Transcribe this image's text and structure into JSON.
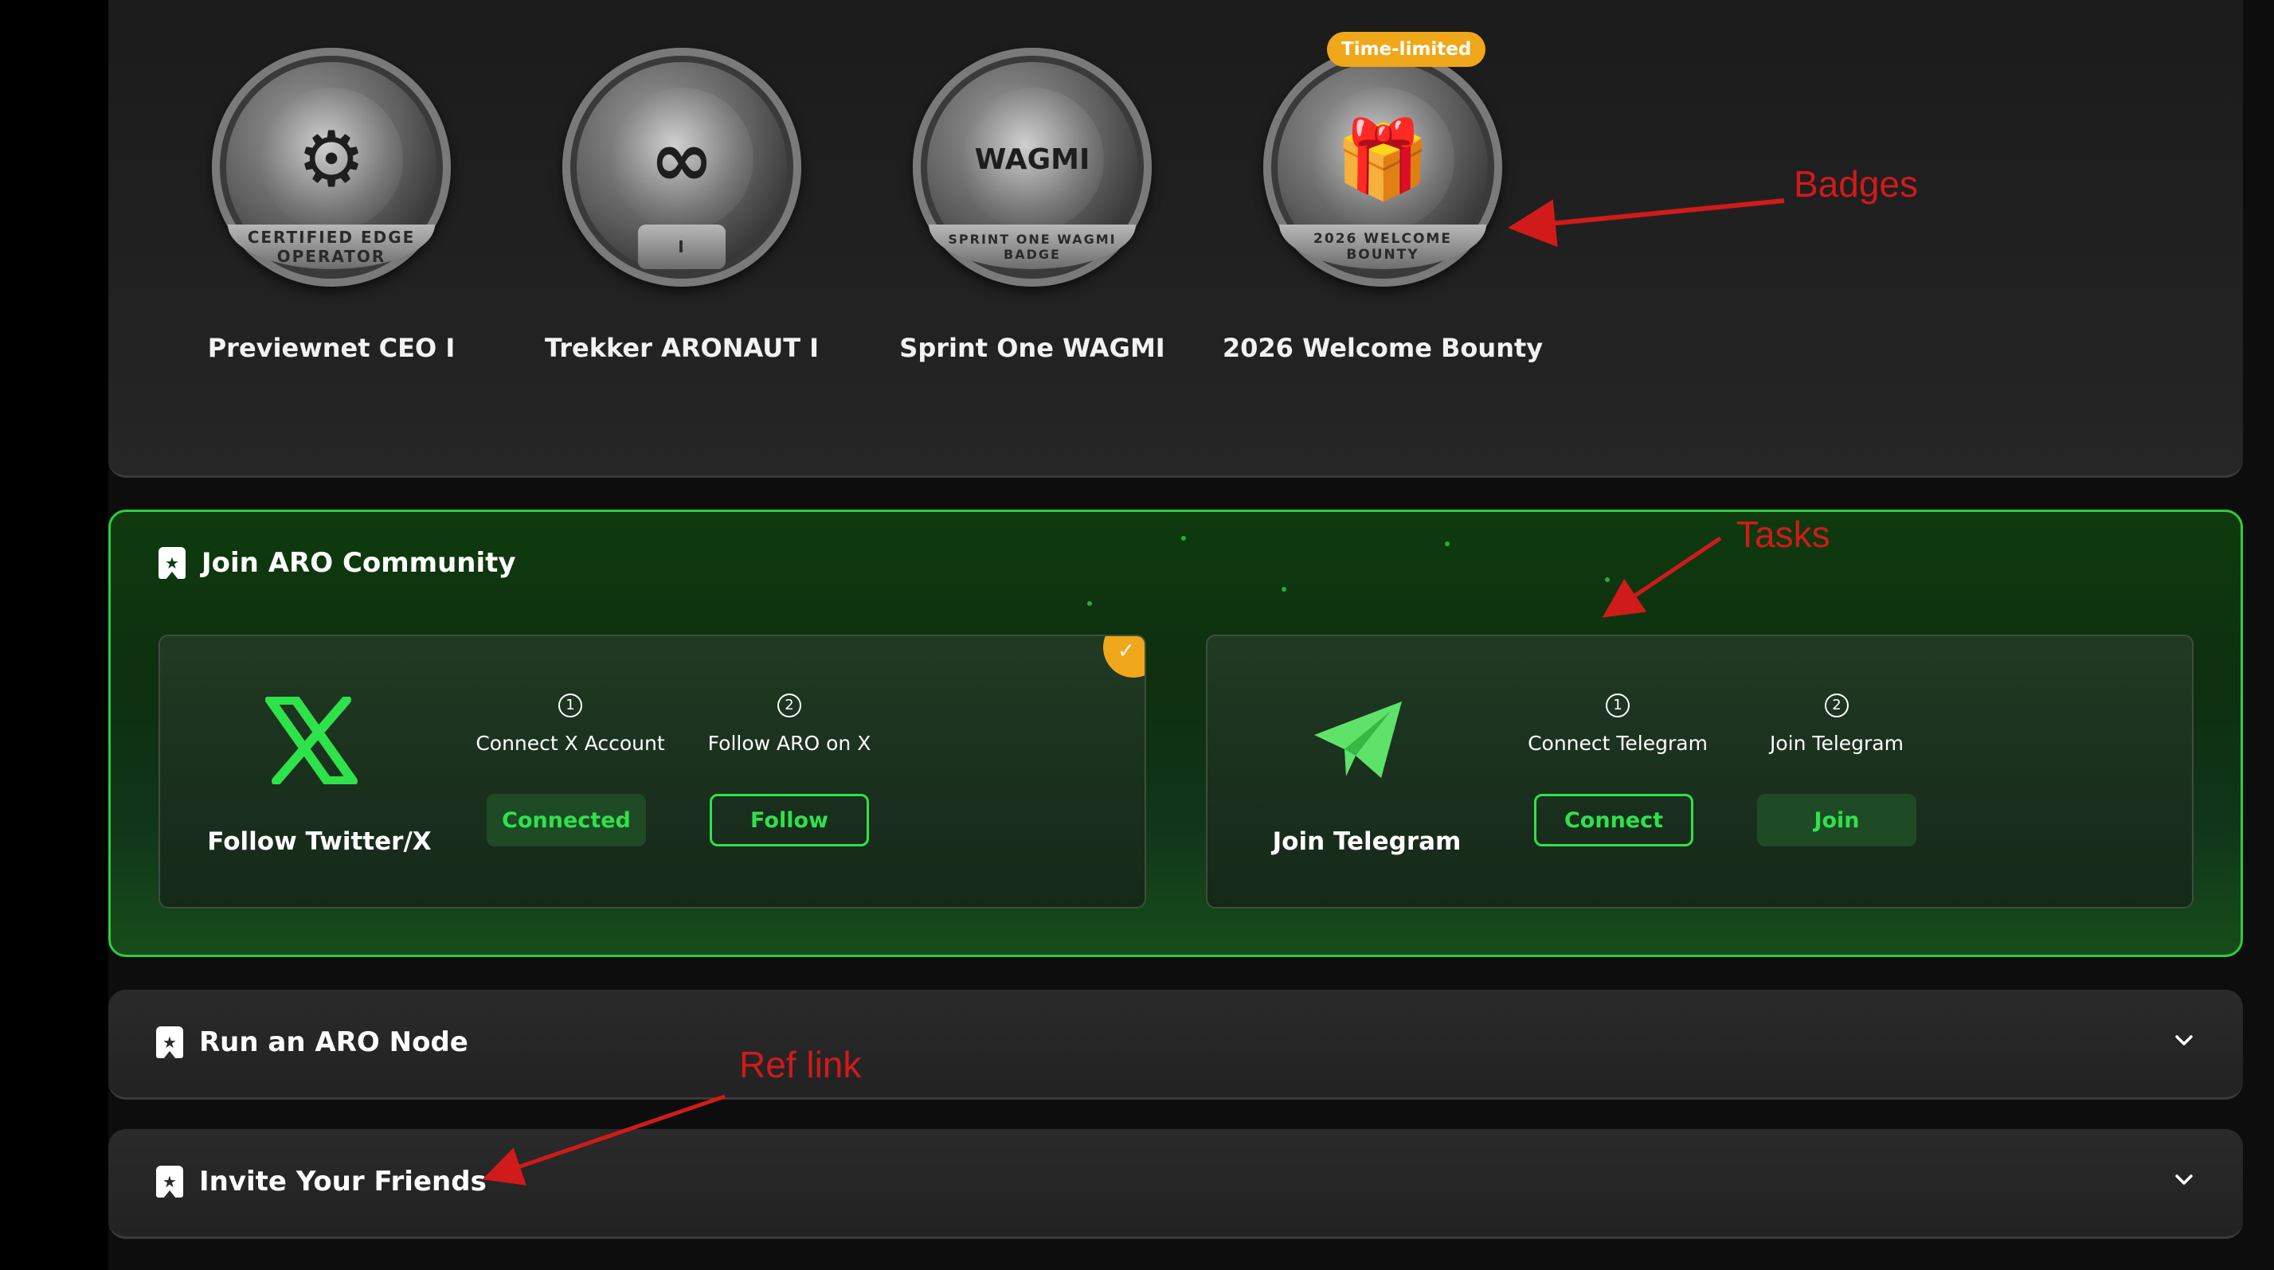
{
  "badges": [
    {
      "title": "Previewnet CEO I",
      "ribbon": "CERTIFIED EDGE OPERATOR",
      "emblem": "robot-operator"
    },
    {
      "title": "Trekker ARONAUT I",
      "ribbon": "I",
      "emblem": "infinity-wave"
    },
    {
      "title": "Sprint One WAGMI",
      "ribbon": "SPRINT ONE WAGMI BADGE",
      "emblem": "WAGMI"
    },
    {
      "title": "2026 Welcome Bounty",
      "ribbon": "2026 WELCOME BOUNTY",
      "emblem": "gift-box",
      "tag": "Time-limited"
    }
  ],
  "community": {
    "title": "Join ARO Community",
    "tasks": [
      {
        "name": "Follow Twitter/X",
        "icon": "x-logo-icon",
        "completed": true,
        "steps": [
          {
            "num": "1",
            "label": "Connect X Account",
            "button": "Connected",
            "style": "filled"
          },
          {
            "num": "2",
            "label": "Follow ARO on X",
            "button": "Follow",
            "style": "outline"
          }
        ]
      },
      {
        "name": "Join Telegram",
        "icon": "telegram-icon",
        "completed": false,
        "steps": [
          {
            "num": "1",
            "label": "Connect Telegram",
            "button": "Connect",
            "style": "outline"
          },
          {
            "num": "2",
            "label": "Join Telegram",
            "button": "Join",
            "style": "filled"
          }
        ]
      }
    ]
  },
  "sections": [
    {
      "title": "Run an ARO Node",
      "expanded": false
    },
    {
      "title": "Invite Your Friends",
      "expanded": false
    }
  ],
  "annotations": {
    "badges": "Badges",
    "tasks": "Tasks",
    "ref_link": "Ref link"
  },
  "colors": {
    "accent_green": "#2ee24a",
    "border_green": "#2ecc40",
    "tag_orange": "#f0a719",
    "annotation_red": "#d11a1a"
  }
}
